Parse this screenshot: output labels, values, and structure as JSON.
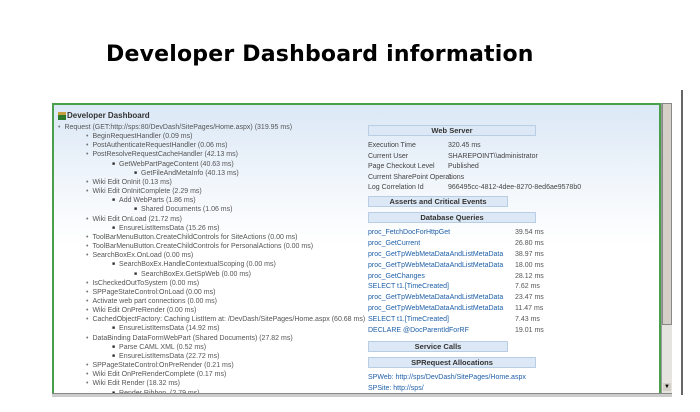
{
  "title": "Developer Dashboard information",
  "dashboard": {
    "title": "Developer Dashboard",
    "tree": [
      {
        "level": 1,
        "text": "Request (GET:http://sps:80/DevDash/SitePages/Home.aspx) (319.95 ms)"
      },
      {
        "level": 2,
        "text": "BeginRequestHandler (0.09 ms)"
      },
      {
        "level": 2,
        "text": "PostAuthenticateRequestHandler (0.06 ms)"
      },
      {
        "level": 2,
        "text": "PostResolveRequestCacheHandler (42.13 ms)"
      },
      {
        "level": 3,
        "text": "GetWebPartPageContent (40.63 ms)"
      },
      {
        "level": 4,
        "text": "GetFileAndMetaInfo (40.13 ms)"
      },
      {
        "level": 2,
        "text": "Wiki Edit OnInit (0.13 ms)"
      },
      {
        "level": 2,
        "text": "Wiki Edit OnInitComplete (2.29 ms)"
      },
      {
        "level": 3,
        "text": "Add WebParts (1.86 ms)"
      },
      {
        "level": 4,
        "text": "Shared Documents (1.06 ms)"
      },
      {
        "level": 2,
        "text": "Wiki Edit OnLoad (21.72 ms)"
      },
      {
        "level": 3,
        "text": "EnsureListItemsData (15.26 ms)"
      },
      {
        "level": 2,
        "text": "ToolBarMenuButton.CreateChildControls for SiteActions (0.00 ms)"
      },
      {
        "level": 2,
        "text": "ToolBarMenuButton.CreateChildControls for PersonalActions (0.00 ms)"
      },
      {
        "level": 2,
        "text": "SearchBoxEx.OnLoad (0.00 ms)"
      },
      {
        "level": 3,
        "text": "SearchBoxEx.HandleContextualScoping (0.00 ms)"
      },
      {
        "level": 4,
        "text": "SearchBoxEx.GetSpWeb (0.00 ms)"
      },
      {
        "level": 2,
        "text": "IsCheckedOutToSystem (0.00 ms)"
      },
      {
        "level": 2,
        "text": "SPPageStateControl:OnLoad (0.00 ms)"
      },
      {
        "level": 2,
        "text": "Activate web part connections (0.00 ms)"
      },
      {
        "level": 2,
        "text": "Wiki Edit OnPreRender (0.00 ms)"
      },
      {
        "level": 2,
        "text": "CachedObjectFactory: Caching ListItem at: /DevDash/SitePages/Home.aspx (60.68 ms)"
      },
      {
        "level": 3,
        "text": "EnsureListItemsData (14.92 ms)"
      },
      {
        "level": 2,
        "text": "DataBinding DataFormWebPart (Shared Documents) (27.82 ms)"
      },
      {
        "level": 3,
        "text": "Parse CAML XML (0.52 ms)"
      },
      {
        "level": 3,
        "text": "EnsureListItemsData (22.72 ms)"
      },
      {
        "level": 2,
        "text": "SPPageStateControl:OnPreRender (0.21 ms)"
      },
      {
        "level": 2,
        "text": "Wiki Edit OnPreRenderComplete (0.17 ms)"
      },
      {
        "level": 2,
        "text": "Wiki Edit Render (18.32 ms)"
      },
      {
        "level": 3,
        "text": "Render Ribbon. (2.79 ms)"
      }
    ],
    "web_server": {
      "header": "Web Server",
      "rows": [
        {
          "k": "Execution Time",
          "v": "320.45 ms"
        },
        {
          "k": "Current User",
          "v": "SHAREPOINT\\\\administrator"
        },
        {
          "k": "Page Checkout Level",
          "v": "Published"
        },
        {
          "k": "Current SharePoint Operations",
          "v": "1"
        },
        {
          "k": "Log Correlation Id",
          "v": "966495cc-4812-4dee-8270-8ed6ae9578b0"
        }
      ]
    },
    "asserts_header": "Asserts and Critical Events",
    "db": {
      "header": "Database Queries",
      "rows": [
        {
          "n": "proc_FetchDocForHttpGet",
          "v": "39.54 ms"
        },
        {
          "n": "proc_GetCurrent",
          "v": "26.80 ms"
        },
        {
          "n": "proc_GetTpWebMetaDataAndListMetaData",
          "v": "38.97 ms"
        },
        {
          "n": "proc_GetTpWebMetaDataAndListMetaData",
          "v": "18.00 ms"
        },
        {
          "n": "proc_GetChanges",
          "v": "28.12 ms"
        },
        {
          "n": "SELECT t1.[TimeCreated]",
          "v": "7.62 ms"
        },
        {
          "n": "proc_GetTpWebMetaDataAndListMetaData",
          "v": "23.47 ms"
        },
        {
          "n": "proc_GetTpWebMetaDataAndListMetaData",
          "v": "11.47 ms"
        },
        {
          "n": "SELECT t1.[TimeCreated]",
          "v": "7.43 ms"
        },
        {
          "n": "DECLARE @DocParentIdForRF",
          "v": "19.01 ms"
        }
      ]
    },
    "service_calls_header": "Service Calls",
    "sprequest": {
      "header": "SPRequest Allocations",
      "links": [
        "SPWeb: http://sps/DevDash/SitePages/Home.aspx",
        "SPSite: http://sps/"
      ]
    }
  }
}
